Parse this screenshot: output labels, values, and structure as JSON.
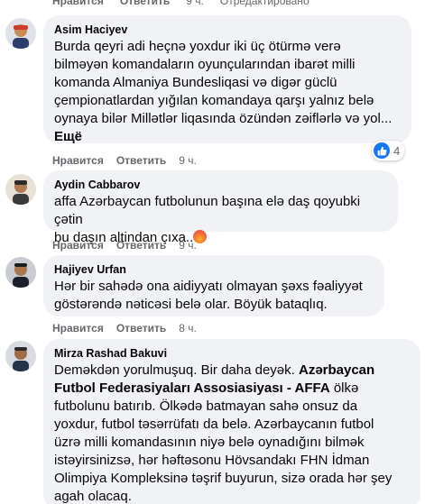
{
  "top_bar": {
    "like_label": "Нравится",
    "reply_label": "Ответить",
    "time": "9 ч.",
    "edited": "Отредактировано"
  },
  "comments": [
    {
      "author": "Asim Haciyev",
      "text": "Burda qeyri adi heçnə yoxdur iki üç ötürmə verə\nbilməyən komandaların oyunçularından ibarət milli\nkomanda Almaniya Bundesliqasi və digər güclü\nçempionatlardan yığılan komandaya qarşı yalnız belə\noynaya bilər Millətlər liqasında özündən zəiflərlə və yol...",
      "more": "Ещё",
      "like_label": "Нравится",
      "reply_label": "Ответить",
      "time": "9 ч.",
      "reaction_count": "4",
      "reaction_icon": "like-icon"
    },
    {
      "author": "Aydin Cabbarov",
      "text": "affa Azərbaycan futbolunun başına elə daş qoyubki çətin\nbu daşın altindan çıxa..",
      "emoji": "angry-emoji",
      "like_label": "Нравится",
      "reply_label": "Ответить",
      "time": "9 ч."
    },
    {
      "author": "Hajiyev Urfan",
      "text": "Hər bir sahədə ona aidiyyatı olmayan şəxs fəaliyyət\ngöstərəndə nəticəsi belə olar. Böyük bataqlıq.",
      "like_label": "Нравится",
      "reply_label": "Ответить",
      "time": "8 ч."
    },
    {
      "author": "Mirza Rashad Bakuvi",
      "text_before": "Deməkdən yorulmuşuq. Bir daha deyək. ",
      "text_bold": "Azərbaycan\nFutbol Federasiyaları Assosiasiyası - AFFA",
      "text_after": " ölkə\nfutbolunu batırıb. Ölkədə batmayan sahə onsuz da\nyoxdur, futbol təsərrüfatı da belə. Azərbaycanın futbol\nüzrə milli komandasının niyə belə oynadığını bilmək\nistəyirsinizsə, hər həftəsonu Hövsandakı FHN İdman\nOlimpiya Kompleksinə təşrif buyurun, sizə orada hər şey\nagah olacaq."
    }
  ],
  "colors": {
    "bubble": "#f0f2f5",
    "meta": "#65676b",
    "like_blue": "#1877f2"
  }
}
